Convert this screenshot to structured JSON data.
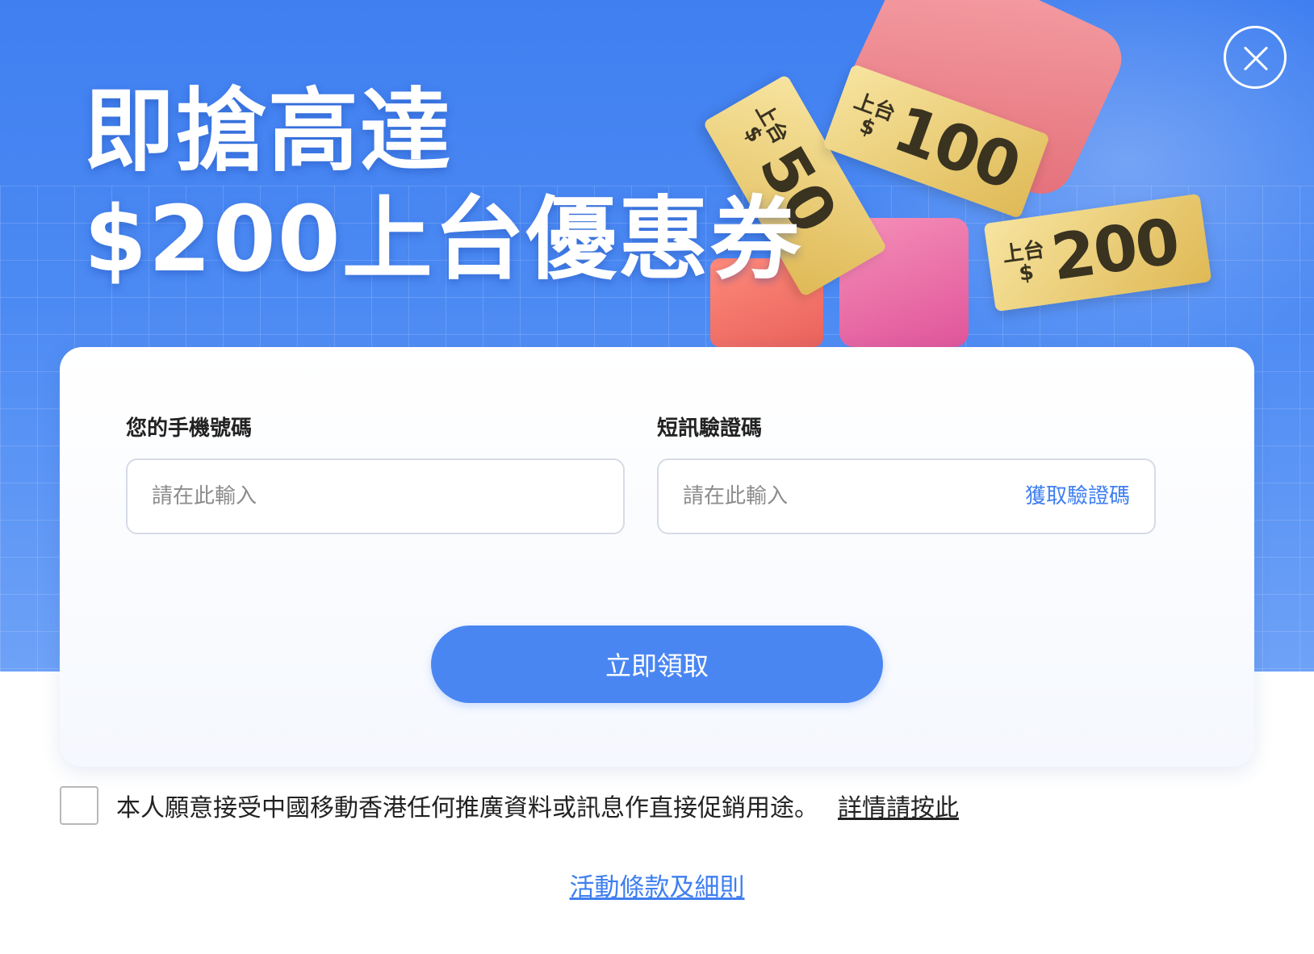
{
  "hero": {
    "headline_line1": "即搶高達",
    "headline_line2": "$200上台優惠券",
    "tickets": [
      {
        "prefix": "上台",
        "currency": "$",
        "amount": "50"
      },
      {
        "prefix": "上台",
        "currency": "$",
        "amount": "100"
      },
      {
        "prefix": "上台",
        "currency": "$",
        "amount": "200"
      }
    ],
    "close_icon": "close-icon"
  },
  "form": {
    "phone_label": "您的手機號碼",
    "phone_placeholder": "請在此輸入",
    "sms_label": "短訊驗證碼",
    "sms_placeholder": "請在此輸入",
    "get_code_label": "獲取驗證碼",
    "submit_label": "立即領取"
  },
  "consent": {
    "text": "本人願意接受中國移動香港任何推廣資料或訊息作直接促銷用途。",
    "link_label": "詳情請按此",
    "checked": false
  },
  "footer": {
    "terms_label": "活動條款及細則"
  },
  "colors": {
    "hero_blue": "#3f7ff0",
    "button_blue": "#4a86f2",
    "link_blue": "#3f7ff0"
  }
}
